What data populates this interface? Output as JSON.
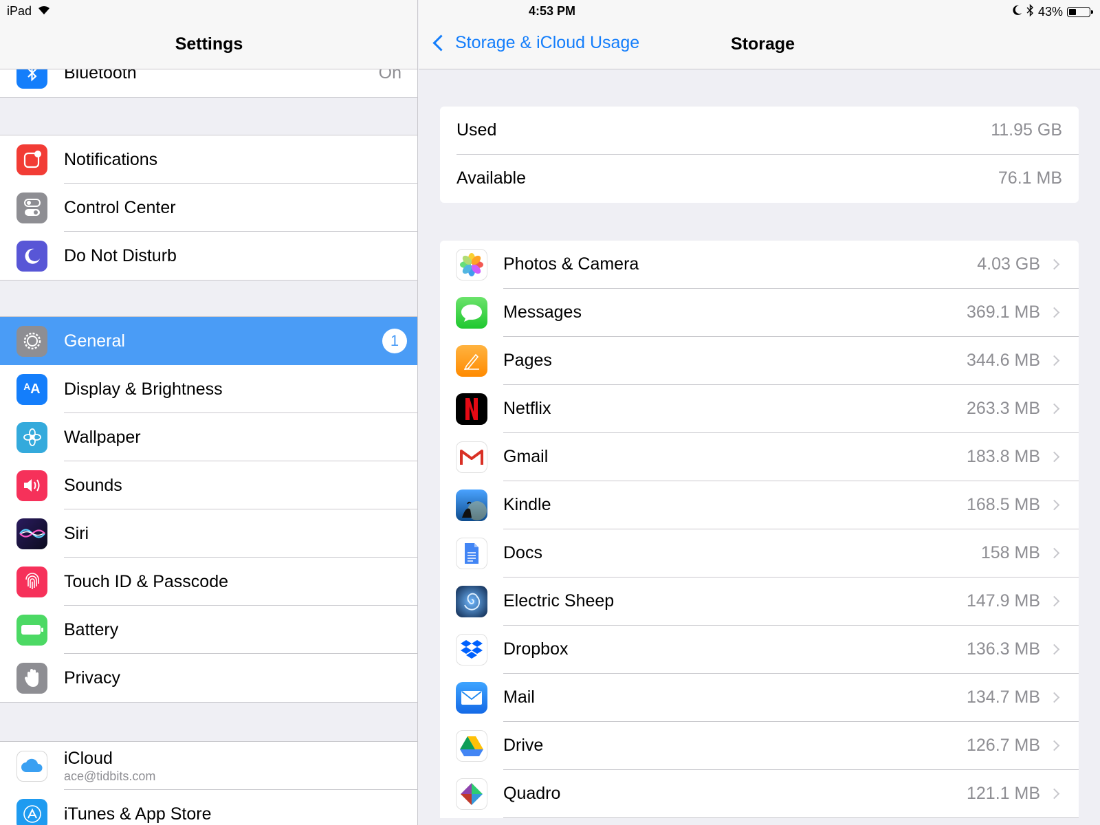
{
  "status": {
    "device": "iPad",
    "time": "4:53 PM",
    "battery": "43%",
    "battery_level": 0.43
  },
  "master": {
    "title": "Settings",
    "partial_row": {
      "label": "Bluetooth",
      "value": "On"
    },
    "group1": [
      {
        "label": "Notifications",
        "icon": "notifications-icon",
        "color": "#f23c35"
      },
      {
        "label": "Control Center",
        "icon": "control-center-icon",
        "color": "#8e8e93"
      },
      {
        "label": "Do Not Disturb",
        "icon": "moon-icon",
        "color": "#5856d6"
      }
    ],
    "group2": [
      {
        "label": "General",
        "icon": "gear-icon",
        "color": "#8e8e93",
        "badge": "1",
        "selected": true
      },
      {
        "label": "Display & Brightness",
        "icon": "display-icon",
        "color": "#147efb"
      },
      {
        "label": "Wallpaper",
        "icon": "wallpaper-icon",
        "color": "#34aadc"
      },
      {
        "label": "Sounds",
        "icon": "speaker-icon",
        "color": "#f6315a"
      },
      {
        "label": "Siri",
        "icon": "siri-icon",
        "color": "#1c1c3a"
      },
      {
        "label": "Touch ID & Passcode",
        "icon": "fingerprint-icon",
        "color": "#f6315a"
      },
      {
        "label": "Battery",
        "icon": "battery-icon",
        "color": "#4cd964"
      },
      {
        "label": "Privacy",
        "icon": "hand-icon",
        "color": "#8e8e93"
      }
    ],
    "group3": [
      {
        "label": "iCloud",
        "sublabel": "ace@tidbits.com",
        "icon": "icloud-icon",
        "color": "#ffffff"
      },
      {
        "label": "iTunes & App Store",
        "icon": "app-store-icon",
        "color": "#1e9bf0"
      }
    ]
  },
  "detail": {
    "back_label": "Storage & iCloud Usage",
    "title": "Storage",
    "summary": [
      {
        "label": "Used",
        "value": "11.95 GB"
      },
      {
        "label": "Available",
        "value": "76.1 MB"
      }
    ],
    "apps": [
      {
        "name": "Photos & Camera",
        "size": "4.03 GB",
        "icon": "photos-icon",
        "color": "#ffffff"
      },
      {
        "name": "Messages",
        "size": "369.1 MB",
        "icon": "messages-icon",
        "color": "#4cd964"
      },
      {
        "name": "Pages",
        "size": "344.6 MB",
        "icon": "pages-icon",
        "color": "#ff9500"
      },
      {
        "name": "Netflix",
        "size": "263.3 MB",
        "icon": "netflix-icon",
        "color": "#000000"
      },
      {
        "name": "Gmail",
        "size": "183.8 MB",
        "icon": "gmail-icon",
        "color": "#ffffff"
      },
      {
        "name": "Kindle",
        "size": "168.5 MB",
        "icon": "kindle-icon",
        "color": "#1d6fb8"
      },
      {
        "name": "Docs",
        "size": "158 MB",
        "icon": "docs-icon",
        "color": "#ffffff"
      },
      {
        "name": "Electric Sheep",
        "size": "147.9 MB",
        "icon": "electric-sheep-icon",
        "color": "#1a3a6e"
      },
      {
        "name": "Dropbox",
        "size": "136.3 MB",
        "icon": "dropbox-icon",
        "color": "#ffffff"
      },
      {
        "name": "Mail",
        "size": "134.7 MB",
        "icon": "mail-icon",
        "color": "#1e88f0"
      },
      {
        "name": "Drive",
        "size": "126.7 MB",
        "icon": "drive-icon",
        "color": "#ffffff"
      },
      {
        "name": "Quadro",
        "size": "121.1 MB",
        "icon": "quadro-icon",
        "color": "#ffffff"
      }
    ]
  }
}
